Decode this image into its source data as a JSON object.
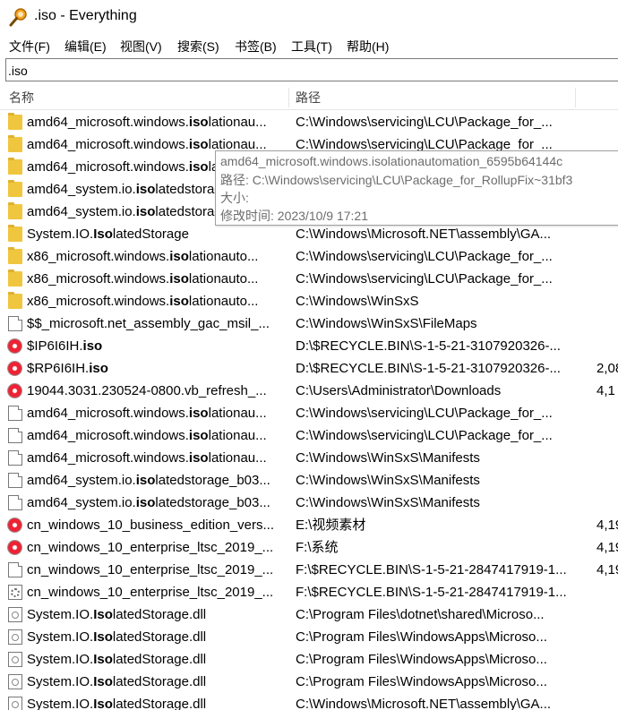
{
  "window": {
    "title": ".iso - Everything"
  },
  "menu": [
    "文件(F)",
    "编辑(E)",
    "视图(V)",
    "搜索(S)",
    "书签(B)",
    "工具(T)",
    "帮助(H)"
  ],
  "search": {
    "value": ".iso"
  },
  "columns": {
    "name": "名称",
    "path": "路径"
  },
  "rows": [
    {
      "icon": "folder-icon",
      "pre": "amd64_microsoft.windows.",
      "hl": "iso",
      "post": "lationau...",
      "path": "C:\\Windows\\servicing\\LCU\\Package_for_...",
      "size": ""
    },
    {
      "icon": "folder-icon",
      "pre": "amd64_microsoft.windows.",
      "hl": "iso",
      "post": "lationau...",
      "path": "C:\\Windows\\servicing\\LCU\\Package_for_...",
      "size": ""
    },
    {
      "icon": "folder-icon",
      "pre": "amd64_microsoft.windows.",
      "hl": "iso",
      "post": "lationau...",
      "path": "C:\\Windows\\WinSxS",
      "size": ""
    },
    {
      "icon": "folder-icon",
      "pre": "amd64_system.io.",
      "hl": "iso",
      "post": "latedstorage_b03...",
      "path": "C:\\Windows\\WinSxS",
      "size": ""
    },
    {
      "icon": "folder-icon",
      "pre": "amd64_system.io.",
      "hl": "iso",
      "post": "latedstorage_b03...",
      "path": "C:\\Windows\\WinSxS",
      "size": ""
    },
    {
      "icon": "folder-icon",
      "pre": "System.IO.",
      "hl": "Iso",
      "post": "latedStorage",
      "path": "C:\\Windows\\Microsoft.NET\\assembly\\GA...",
      "size": ""
    },
    {
      "icon": "folder-icon",
      "pre": "x86_microsoft.windows.",
      "hl": "iso",
      "post": "lationauto...",
      "path": "C:\\Windows\\servicing\\LCU\\Package_for_...",
      "size": ""
    },
    {
      "icon": "folder-icon",
      "pre": "x86_microsoft.windows.",
      "hl": "iso",
      "post": "lationauto...",
      "path": "C:\\Windows\\servicing\\LCU\\Package_for_...",
      "size": ""
    },
    {
      "icon": "folder-icon",
      "pre": "x86_microsoft.windows.",
      "hl": "iso",
      "post": "lationauto...",
      "path": "C:\\Windows\\WinSxS",
      "size": ""
    },
    {
      "icon": "file-icon",
      "pre": "$$_microsoft.net_assembly_gac_msil_...",
      "hl": "",
      "post": "",
      "path": "C:\\Windows\\WinSxS\\FileMaps",
      "size": ""
    },
    {
      "icon": "disc-image-icon",
      "pre": "$IP6I6IH.",
      "hl": "iso",
      "post": "",
      "path": "D:\\$RECYCLE.BIN\\S-1-5-21-3107920326-...",
      "size": ""
    },
    {
      "icon": "disc-image-icon",
      "pre": "$RP6I6IH.",
      "hl": "iso",
      "post": "",
      "path": "D:\\$RECYCLE.BIN\\S-1-5-21-3107920326-...",
      "size": "2,08"
    },
    {
      "icon": "disc-image-icon",
      "pre": "19044.3031.230524-0800.vb_refresh_...",
      "hl": "",
      "post": "",
      "path": "C:\\Users\\Administrator\\Downloads",
      "size": "4,1"
    },
    {
      "icon": "file-icon",
      "pre": "amd64_microsoft.windows.",
      "hl": "iso",
      "post": "lationau...",
      "path": "C:\\Windows\\servicing\\LCU\\Package_for_...",
      "size": ""
    },
    {
      "icon": "file-icon",
      "pre": "amd64_microsoft.windows.",
      "hl": "iso",
      "post": "lationau...",
      "path": "C:\\Windows\\servicing\\LCU\\Package_for_...",
      "size": ""
    },
    {
      "icon": "file-icon",
      "pre": "amd64_microsoft.windows.",
      "hl": "iso",
      "post": "lationau...",
      "path": "C:\\Windows\\WinSxS\\Manifests",
      "size": ""
    },
    {
      "icon": "file-icon",
      "pre": "amd64_system.io.",
      "hl": "iso",
      "post": "latedstorage_b03...",
      "path": "C:\\Windows\\WinSxS\\Manifests",
      "size": ""
    },
    {
      "icon": "file-icon",
      "pre": "amd64_system.io.",
      "hl": "iso",
      "post": "latedstorage_b03...",
      "path": "C:\\Windows\\WinSxS\\Manifests",
      "size": ""
    },
    {
      "icon": "disc-image-icon",
      "pre": "cn_windows_10_business_edition_vers...",
      "hl": "",
      "post": "",
      "path": "E:\\视频素材",
      "size": "4,19"
    },
    {
      "icon": "disc-image-icon",
      "pre": "cn_windows_10_enterprise_ltsc_2019_...",
      "hl": "",
      "post": "",
      "path": "F:\\系统",
      "size": "4,19"
    },
    {
      "icon": "file-icon",
      "pre": "cn_windows_10_enterprise_ltsc_2019_...",
      "hl": "",
      "post": "",
      "path": "F:\\$RECYCLE.BIN\\S-1-5-21-2847417919-1...",
      "size": "4,19"
    },
    {
      "icon": "gear-file-icon",
      "pre": "cn_windows_10_enterprise_ltsc_2019_...",
      "hl": "",
      "post": "",
      "path": "F:\\$RECYCLE.BIN\\S-1-5-21-2847417919-1...",
      "size": ""
    },
    {
      "icon": "dll-icon",
      "pre": "System.IO.",
      "hl": "Iso",
      "post": "latedStorage.dll",
      "path": "C:\\Program Files\\dotnet\\shared\\Microso...",
      "size": ""
    },
    {
      "icon": "dll-icon",
      "pre": "System.IO.",
      "hl": "Iso",
      "post": "latedStorage.dll",
      "path": "C:\\Program Files\\WindowsApps\\Microso...",
      "size": ""
    },
    {
      "icon": "dll-icon",
      "pre": "System.IO.",
      "hl": "Iso",
      "post": "latedStorage.dll",
      "path": "C:\\Program Files\\WindowsApps\\Microso...",
      "size": ""
    },
    {
      "icon": "dll-icon",
      "pre": "System.IO.",
      "hl": "Iso",
      "post": "latedStorage.dll",
      "path": "C:\\Program Files\\WindowsApps\\Microso...",
      "size": ""
    },
    {
      "icon": "dll-icon",
      "pre": "System.IO.",
      "hl": "Iso",
      "post": "latedStorage.dll",
      "path": "C:\\Windows\\Microsoft.NET\\assembly\\GA...",
      "size": ""
    }
  ],
  "tooltip": {
    "name": "amd64_microsoft.windows.isolationautomation_6595b64144c",
    "path": "路径: C:\\Windows\\servicing\\LCU\\Package_for_RollupFix~31bf3",
    "size": "大小:",
    "modified": "修改时间: 2023/10/9 17:21"
  },
  "colors": {
    "folder": "#f0c63f",
    "tooltip_text": "#6d6d6d"
  }
}
